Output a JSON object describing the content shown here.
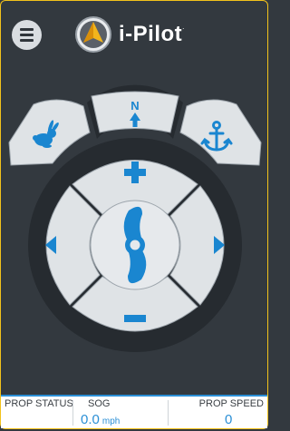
{
  "header": {
    "brand_name": "i-Pilot",
    "brand_tm": ".",
    "accent_color": "#1a86d0",
    "brand_icon": "compass-logo-icon"
  },
  "controls": {
    "north_label": "N",
    "left_icon": "rabbit-icon",
    "right_icon": "anchor-icon",
    "up_icon": "plus-icon",
    "down_icon": "minus-icon",
    "steer_left_icon": "left-arrow-icon",
    "steer_right_icon": "right-arrow-icon",
    "center_icon": "propeller-icon"
  },
  "status": {
    "prop_status_label": "PROP STATUS",
    "sog_label": "SOG",
    "sog_value": "0.0",
    "sog_unit": "mph",
    "prop_speed_label": "PROP SPEED",
    "prop_speed_value": "0"
  }
}
